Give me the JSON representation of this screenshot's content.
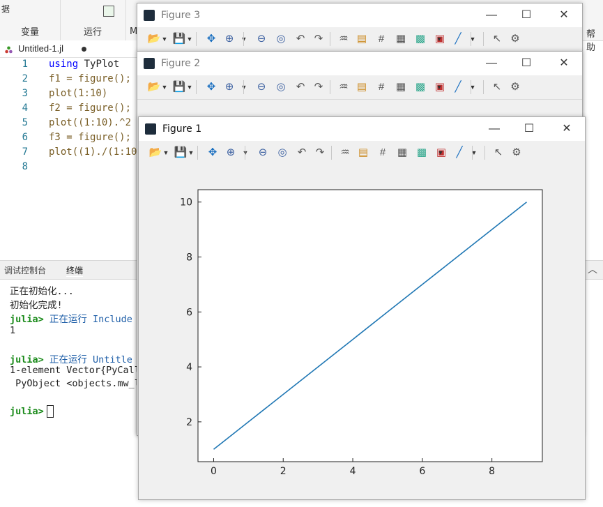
{
  "ide": {
    "ribbon": {
      "group1_label": "变量",
      "group1_small": "据",
      "group2_label": "运行",
      "group3_label": "M",
      "right_label": "帮助"
    },
    "editor": {
      "tab_name": "Untitled-1.jl",
      "lines": [
        {
          "n": "1",
          "pre": "",
          "kw": "using",
          "rest": " TyPlot"
        },
        {
          "n": "2",
          "pre": "f1 = figure();",
          "kw": "",
          "rest": ""
        },
        {
          "n": "3",
          "pre": "plot(1:10)",
          "kw": "",
          "rest": ""
        },
        {
          "n": "4",
          "pre": "f2 = figure();",
          "kw": "",
          "rest": ""
        },
        {
          "n": "5",
          "pre": "plot((1:10).^2",
          "kw": "",
          "rest": ""
        },
        {
          "n": "6",
          "pre": "f3 = figure();",
          "kw": "",
          "rest": ""
        },
        {
          "n": "7",
          "pre": "plot((1)./(1:10",
          "kw": "",
          "rest": ""
        },
        {
          "n": "8",
          "pre": "",
          "kw": "",
          "rest": ""
        }
      ]
    },
    "panel_tabs": [
      "调试控制台",
      "终端"
    ],
    "terminal": {
      "line1": "正在初始化...",
      "line2": "初始化完成!",
      "prompt": "julia>",
      "run1": " 正在运行 Include",
      "out1": "1",
      "run2": " 正在运行 Untitle",
      "out2": "1-element Vector{PyCall",
      "out3": " PyObject <objects.mw_l"
    }
  },
  "windows": {
    "fig3_title": "Figure 3",
    "fig2_title": "Figure 2",
    "fig1_title": "Figure 1",
    "min_glyph": "—",
    "max_glyph": "☐",
    "close_glyph": "✕"
  },
  "toolbar_icons": [
    "open-folder-icon",
    "save-icon",
    "pan-icon",
    "zoom-in-icon",
    "zoom-out-icon",
    "zoom-fit-icon",
    "undo-icon",
    "redo-icon",
    "brush-icon",
    "legend-icon",
    "grid-icon",
    "colorbar-icon",
    "colormap-icon",
    "border-icon",
    "line-tool-icon",
    "pointer-icon",
    "settings-icon"
  ],
  "chart_data": {
    "type": "line",
    "x": [
      0,
      1,
      2,
      3,
      4,
      5,
      6,
      7,
      8,
      9
    ],
    "series": [
      {
        "values": [
          1,
          2,
          3,
          4,
          5,
          6,
          7,
          8,
          9,
          10
        ],
        "color": "#1f77b4"
      }
    ],
    "xlim": [
      -0.45,
      9.45
    ],
    "ylim": [
      0.55,
      10.45
    ],
    "xticks": [
      "0",
      "2",
      "4",
      "6",
      "8"
    ],
    "xtick_values": [
      0,
      2,
      4,
      6,
      8
    ],
    "yticks": [
      "2",
      "4",
      "6",
      "8",
      "10"
    ],
    "ytick_values": [
      2,
      4,
      6,
      8,
      10
    ],
    "grid": false
  }
}
